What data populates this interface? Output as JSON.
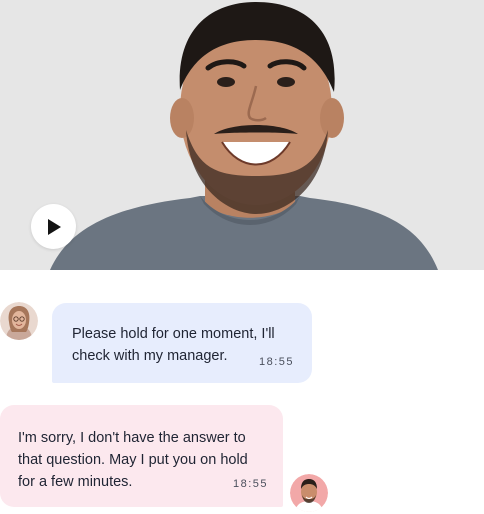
{
  "video": {
    "play_icon": "play-icon",
    "colors": {
      "background": "#e6e6e6",
      "shirt": "#6b7581"
    }
  },
  "chat": {
    "messages": [
      {
        "sender": "agent",
        "avatar_icon": "woman-avatar",
        "lines": [
          "Please hold for one moment, I'll",
          "check with my manager."
        ],
        "time": "18:55",
        "bubble_color": "#e7edfd"
      },
      {
        "sender": "user",
        "avatar_icon": "man-avatar",
        "lines": [
          "I'm sorry, I don't have the answer to",
          "that question. May I put you on hold",
          "for a few minutes."
        ],
        "time": "18:55",
        "bubble_color": "#fce8ee"
      }
    ]
  }
}
